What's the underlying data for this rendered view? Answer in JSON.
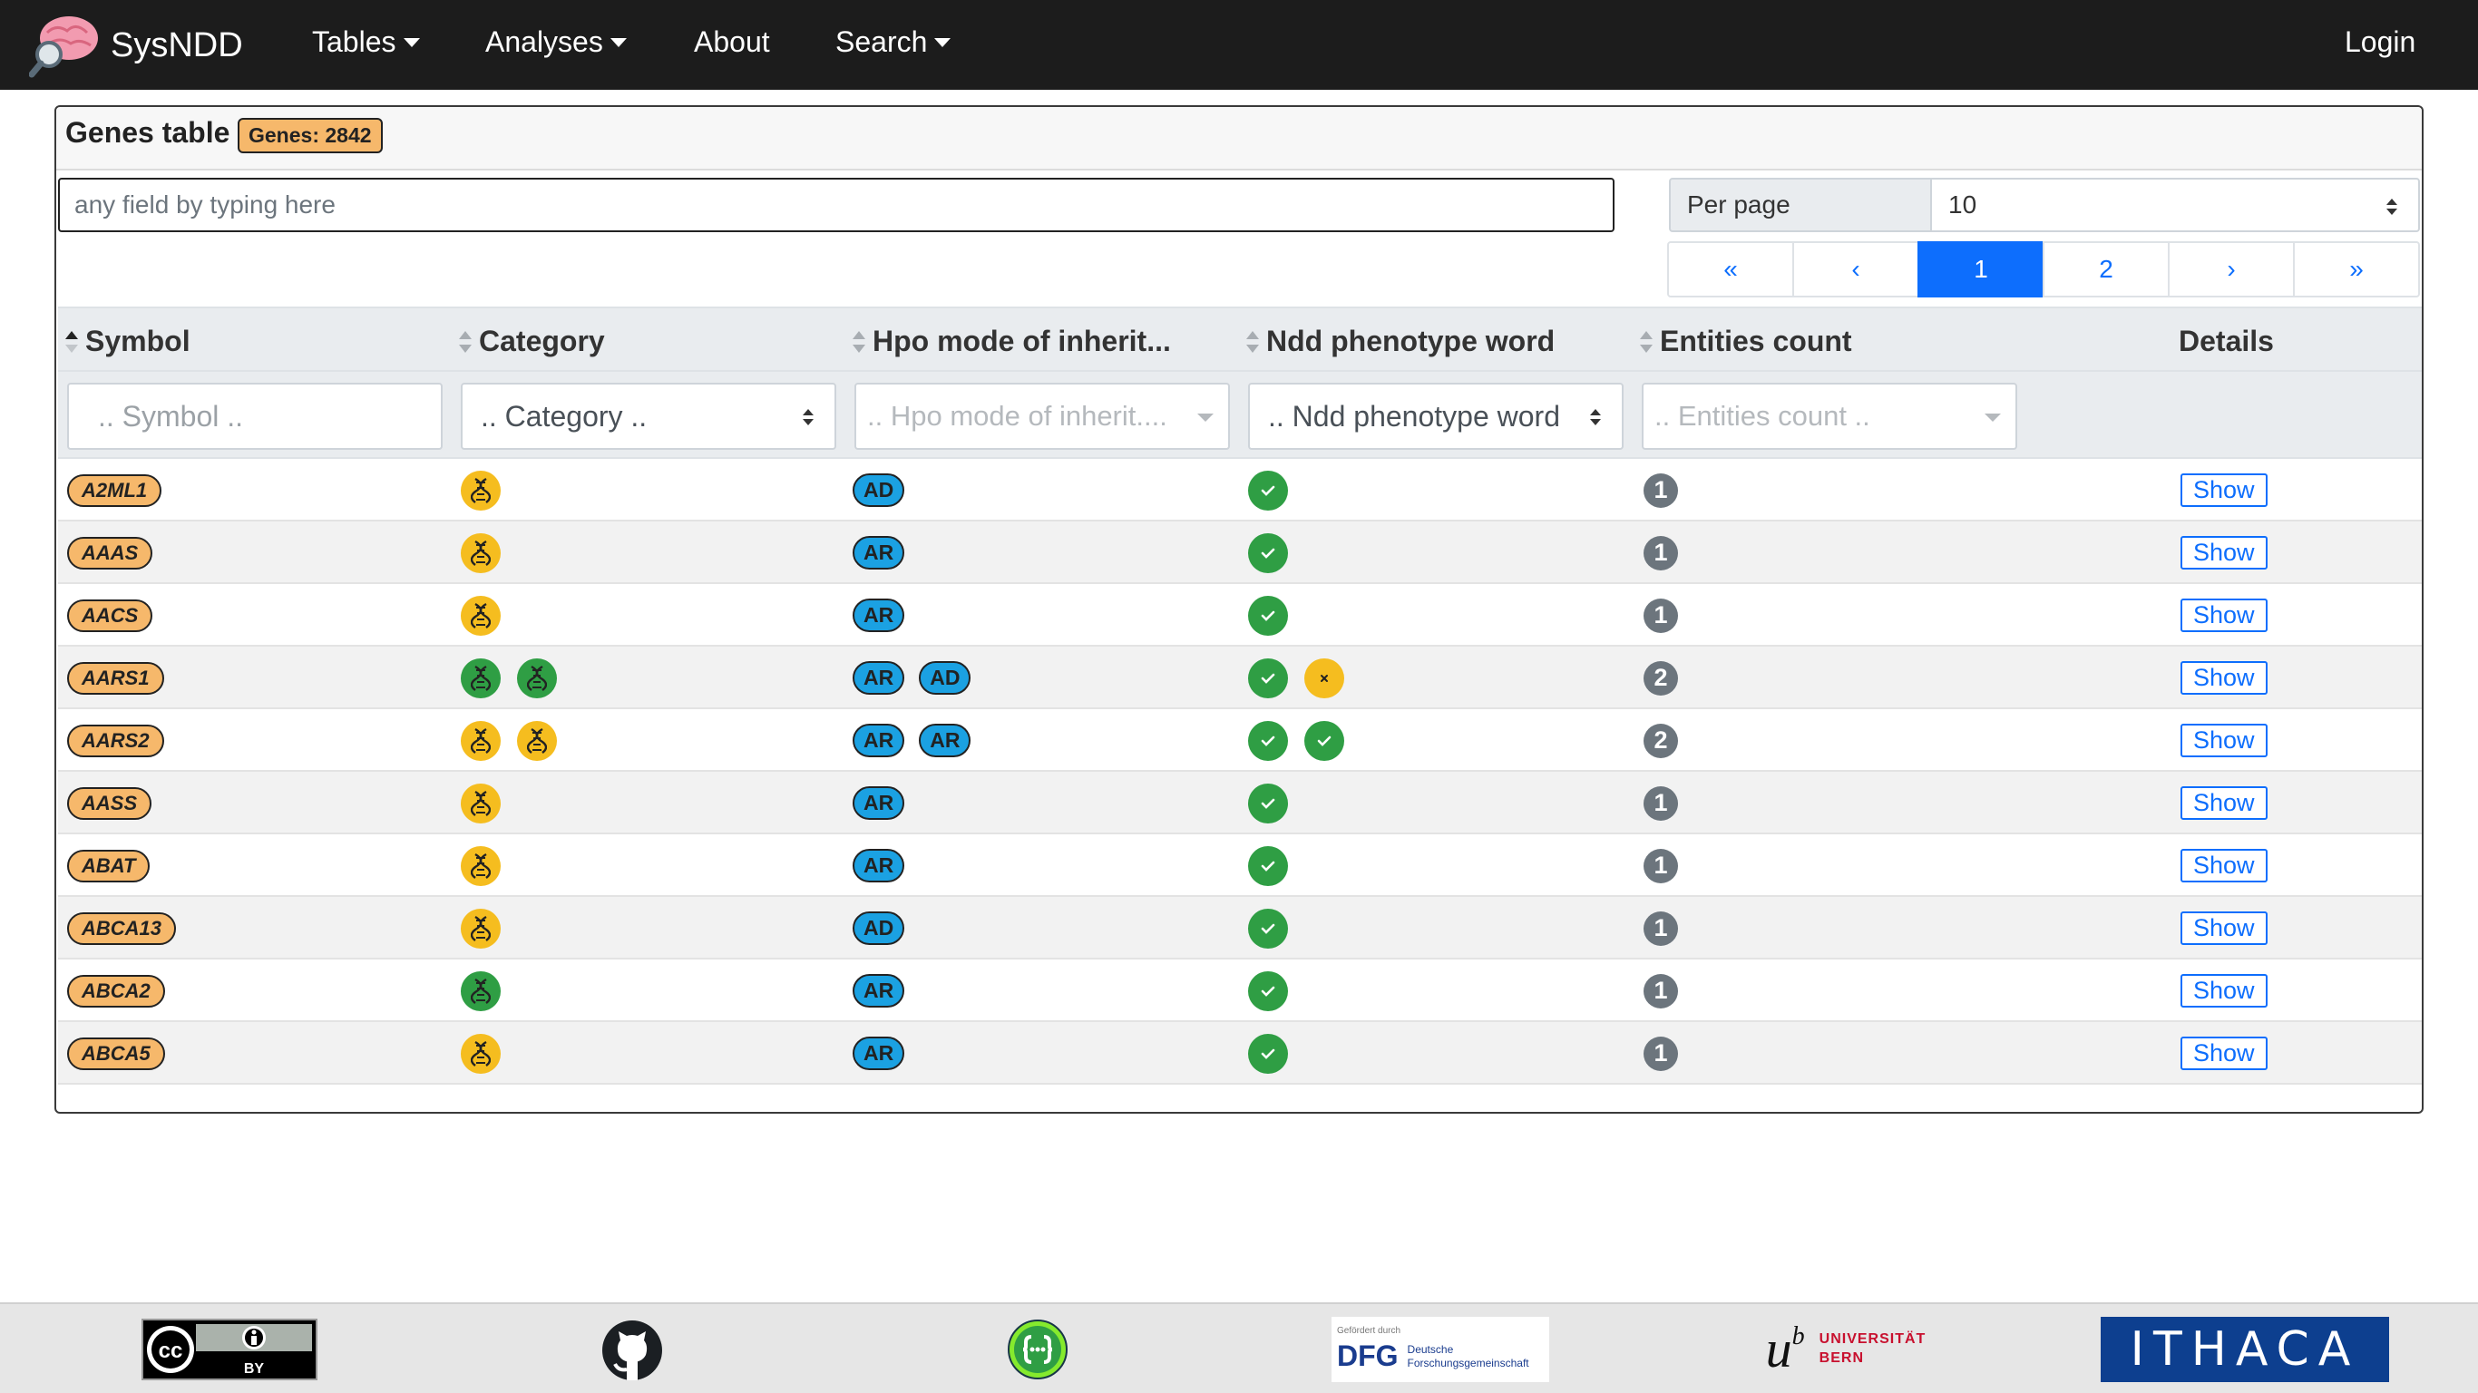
{
  "navbar": {
    "brand": "SysNDD",
    "items": [
      {
        "label": "Tables",
        "dropdown": true
      },
      {
        "label": "Analyses",
        "dropdown": true
      },
      {
        "label": "About",
        "dropdown": false
      },
      {
        "label": "Search",
        "dropdown": true
      }
    ],
    "login": "Login"
  },
  "card": {
    "title": "Genes table",
    "count_badge": "Genes: 2842",
    "search_placeholder": "any field by typing here",
    "per_page_label": "Per page",
    "per_page_value": "10",
    "pagination": [
      "«",
      "‹",
      "1",
      "2",
      "›",
      "»"
    ],
    "active_page": "1"
  },
  "table": {
    "columns": [
      "Symbol",
      "Category",
      "Hpo mode of inherit...",
      "Ndd phenotype word",
      "Entities count",
      "Details"
    ],
    "filters": {
      "symbol": ".. Symbol ..",
      "category": ".. Category ..",
      "hpo": ".. Hpo mode of inherit....",
      "ndd": ".. Ndd phenotype word",
      "entities": ".. Entities count .."
    },
    "show_label": "Show",
    "rows": [
      {
        "symbol": "A2ML1",
        "category": [
          "yellow"
        ],
        "moi": [
          "AD"
        ],
        "ndd": [
          "yes"
        ],
        "count": "1"
      },
      {
        "symbol": "AAAS",
        "category": [
          "yellow"
        ],
        "moi": [
          "AR"
        ],
        "ndd": [
          "yes"
        ],
        "count": "1"
      },
      {
        "symbol": "AACS",
        "category": [
          "yellow"
        ],
        "moi": [
          "AR"
        ],
        "ndd": [
          "yes"
        ],
        "count": "1"
      },
      {
        "symbol": "AARS1",
        "category": [
          "green",
          "green"
        ],
        "moi": [
          "AR",
          "AD"
        ],
        "ndd": [
          "yes",
          "no"
        ],
        "count": "2"
      },
      {
        "symbol": "AARS2",
        "category": [
          "yellow",
          "yellow"
        ],
        "moi": [
          "AR",
          "AR"
        ],
        "ndd": [
          "yes",
          "yes"
        ],
        "count": "2"
      },
      {
        "symbol": "AASS",
        "category": [
          "yellow"
        ],
        "moi": [
          "AR"
        ],
        "ndd": [
          "yes"
        ],
        "count": "1"
      },
      {
        "symbol": "ABAT",
        "category": [
          "yellow"
        ],
        "moi": [
          "AR"
        ],
        "ndd": [
          "yes"
        ],
        "count": "1"
      },
      {
        "symbol": "ABCA13",
        "category": [
          "yellow"
        ],
        "moi": [
          "AD"
        ],
        "ndd": [
          "yes"
        ],
        "count": "1"
      },
      {
        "symbol": "ABCA2",
        "category": [
          "green"
        ],
        "moi": [
          "AR"
        ],
        "ndd": [
          "yes"
        ],
        "count": "1"
      },
      {
        "symbol": "ABCA5",
        "category": [
          "yellow"
        ],
        "moi": [
          "AR"
        ],
        "ndd": [
          "yes"
        ],
        "count": "1"
      }
    ]
  },
  "footer": {
    "logos": [
      "cc-by-icon",
      "github-icon",
      "api-icon",
      "dfg-logo",
      "unibe-logo",
      "ithaca-logo"
    ],
    "dfg_small": "Gefördert durch",
    "dfg_name": "DFG",
    "dfg_sub1": "Deutsche",
    "dfg_sub2": "Forschungsgemeinschaft",
    "unibe_u": "u",
    "unibe_b": "b",
    "unibe_line1": "UNIVERSITÄT",
    "unibe_line2": "BERN",
    "ithaca": "ITHACA",
    "cc": "cc",
    "by": "BY"
  }
}
